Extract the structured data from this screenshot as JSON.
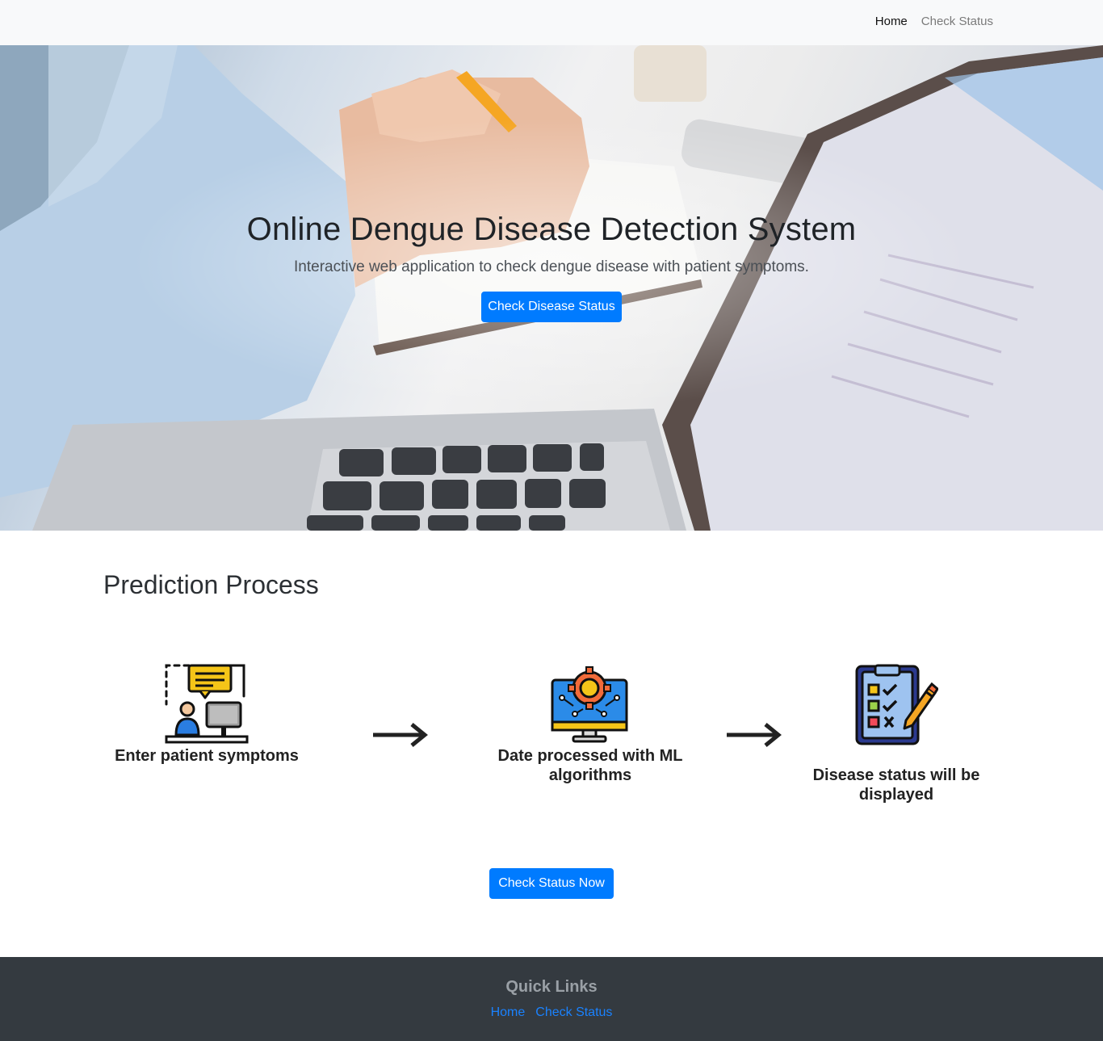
{
  "navbar": {
    "links": [
      {
        "label": "Home",
        "active": true
      },
      {
        "label": "Check Status",
        "active": false
      }
    ]
  },
  "hero": {
    "title": "Online Dengue Disease Detection System",
    "subtitle": "Interactive web application to check dengue disease with patient symptoms.",
    "button_label": "Check Disease Status"
  },
  "process": {
    "title": "Prediction Process",
    "steps": [
      {
        "label": "Enter patient symptoms",
        "icon": "patient-computer-chat-icon"
      },
      {
        "label": "Date processed with ML algorithms",
        "icon": "monitor-gear-icon"
      },
      {
        "label": "Disease status will be displayed",
        "icon": "clipboard-checklist-icon"
      }
    ],
    "arrow_icon": "right-arrow-icon",
    "button_label": "Check Status Now"
  },
  "footer": {
    "title": "Quick Links",
    "links": [
      {
        "label": "Home"
      },
      {
        "label": "Check Status"
      }
    ]
  },
  "colors": {
    "primary": "#007bff",
    "navbar_bg": "#f8f9fa",
    "footer_bg": "#343a40",
    "footer_link": "#1a82ff"
  }
}
